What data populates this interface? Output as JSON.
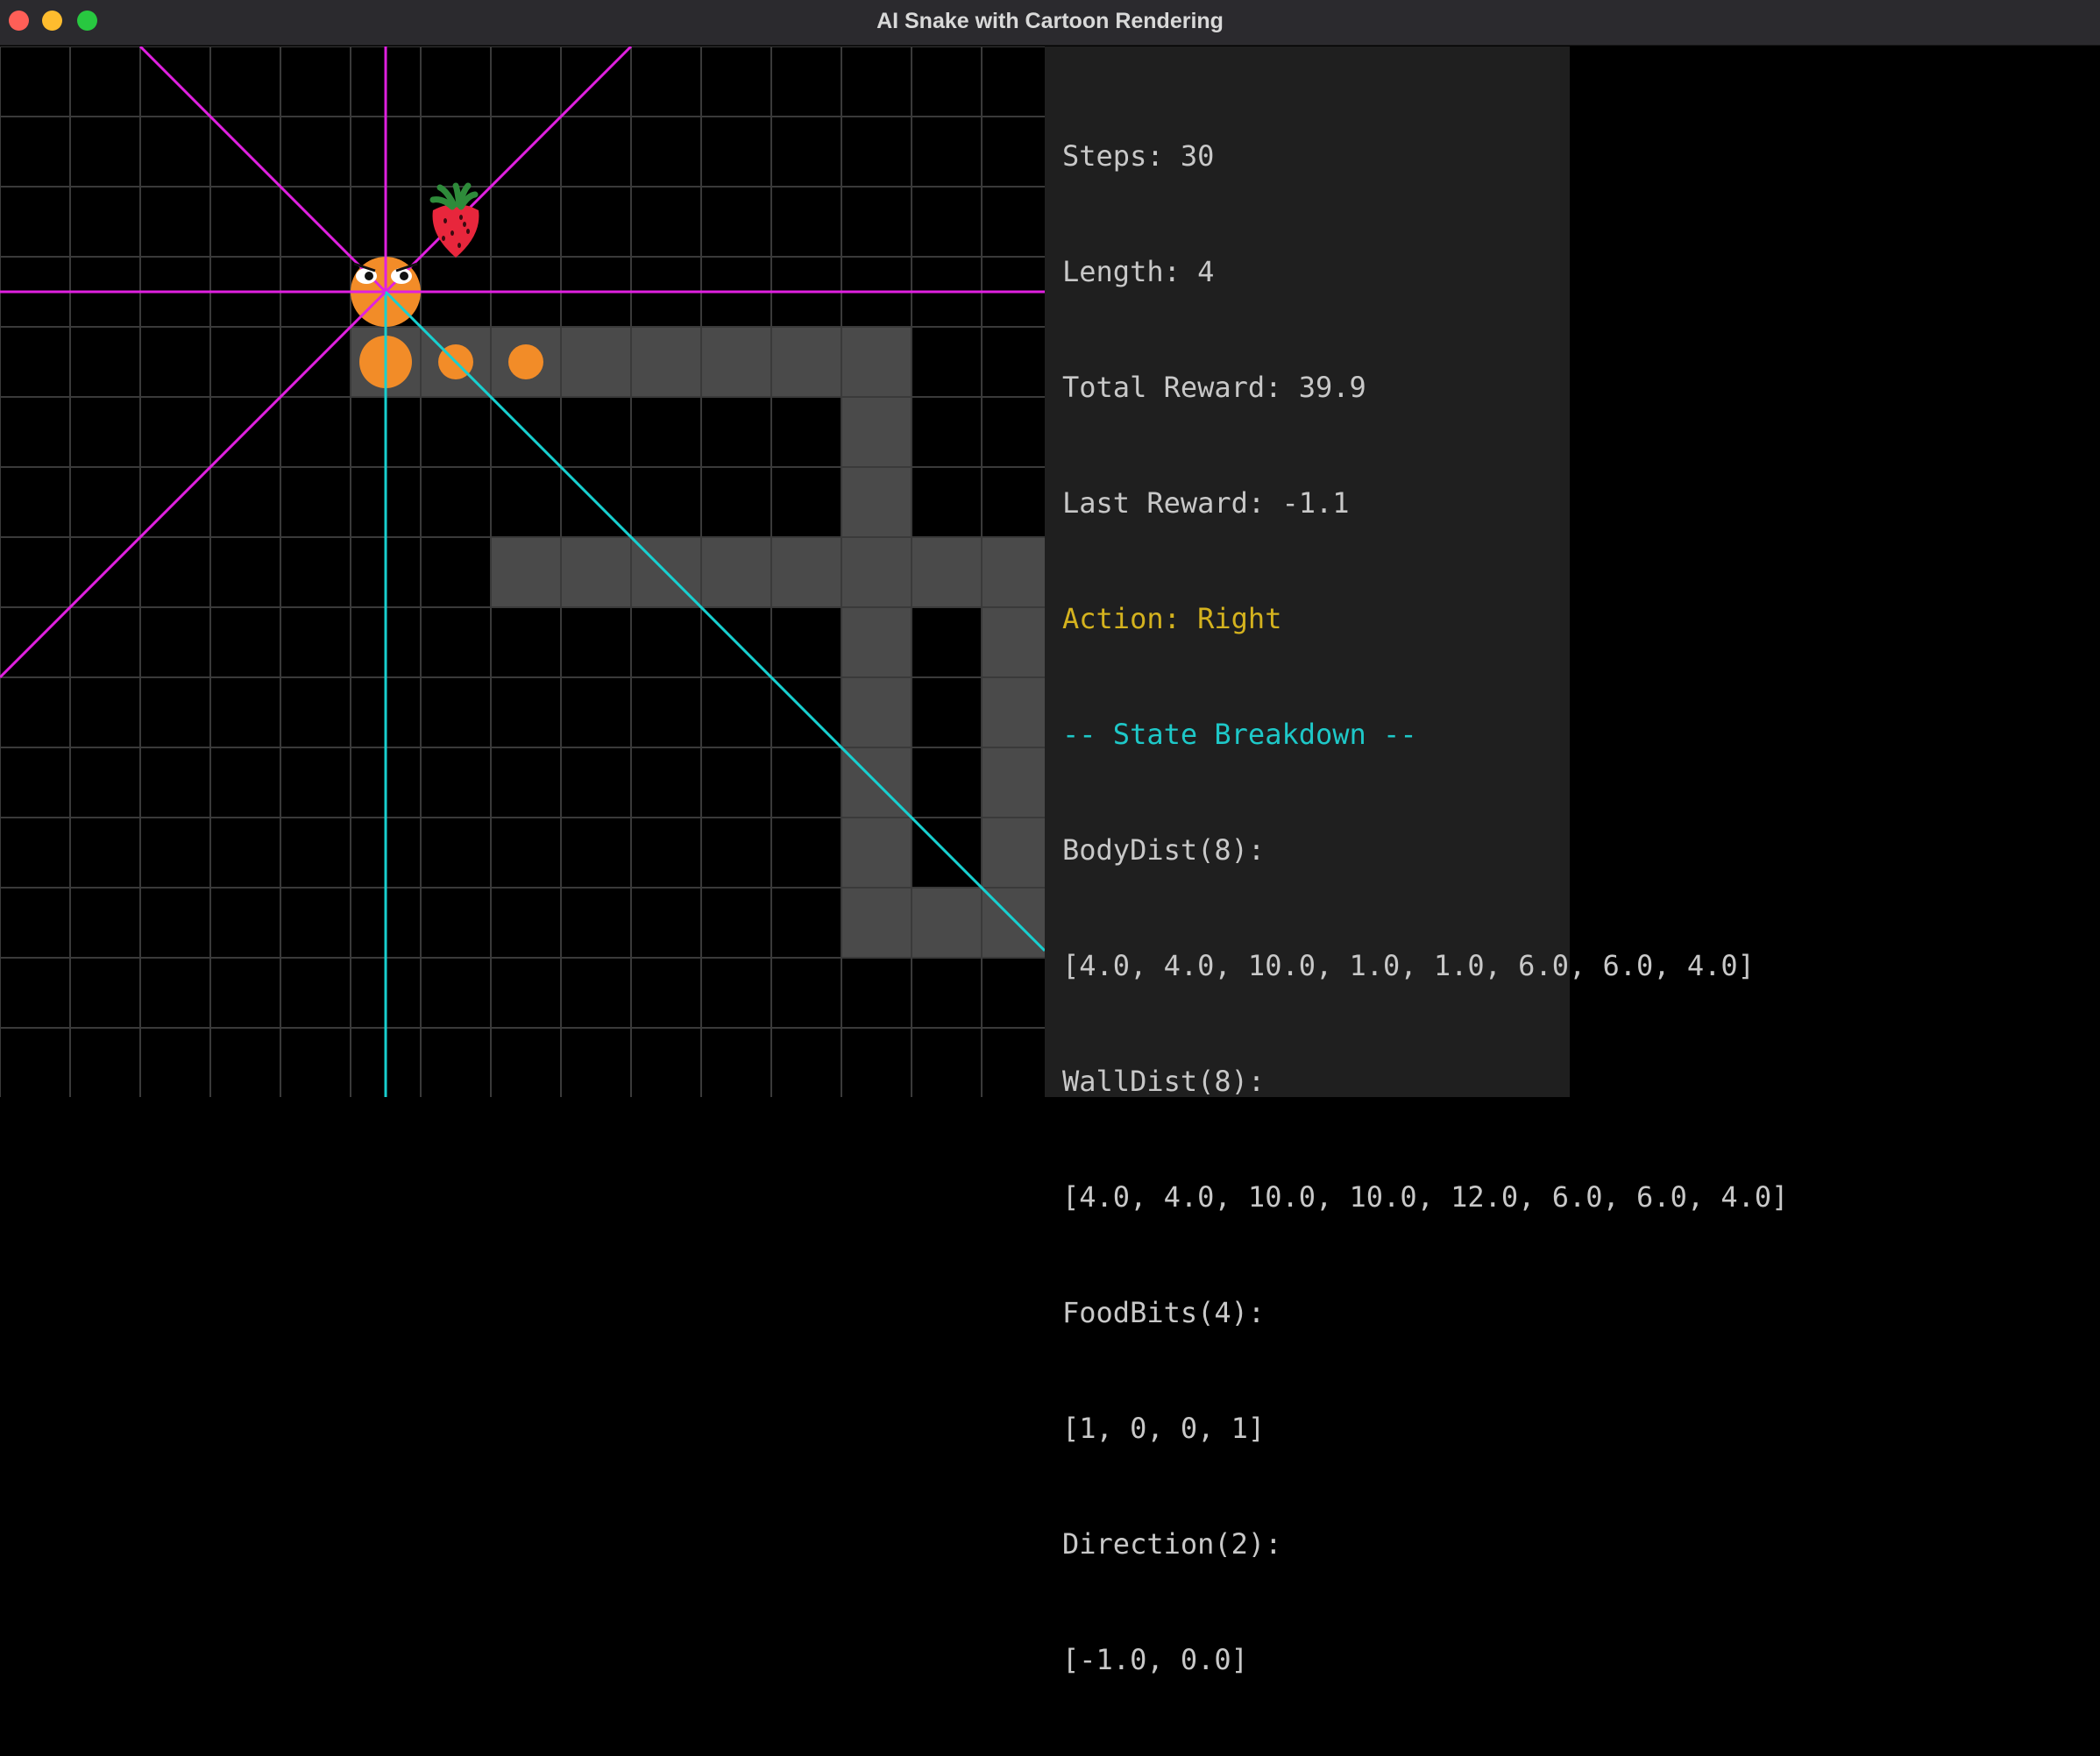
{
  "window": {
    "title": "AI Snake with Cartoon Rendering"
  },
  "colors": {
    "titlebar": "#2b2a2e",
    "board_bg": "#000000",
    "grid_line": "#3a3a3a",
    "obstacle": "#4a4a4a",
    "snake": "#f28c28",
    "food": "#e8263c",
    "ray_magenta": "#e020e0",
    "ray_cyan": "#18d0d0",
    "panel_bg": "#1f1f1f",
    "text_default": "#c8c8c8",
    "text_action": "#d4b21e",
    "text_header": "#1ec8c8"
  },
  "board": {
    "cols": 15,
    "rows": 15,
    "obstacles": [
      [
        5,
        4
      ],
      [
        6,
        4
      ],
      [
        7,
        4
      ],
      [
        8,
        4
      ],
      [
        9,
        4
      ],
      [
        10,
        4
      ],
      [
        11,
        4
      ],
      [
        12,
        4
      ],
      [
        12,
        5
      ],
      [
        12,
        6
      ],
      [
        7,
        7
      ],
      [
        8,
        7
      ],
      [
        9,
        7
      ],
      [
        10,
        7
      ],
      [
        11,
        7
      ],
      [
        12,
        7
      ],
      [
        13,
        7
      ],
      [
        14,
        7
      ],
      [
        12,
        8
      ],
      [
        14,
        8
      ],
      [
        12,
        9
      ],
      [
        14,
        9
      ],
      [
        12,
        10
      ],
      [
        14,
        10
      ],
      [
        12,
        11
      ],
      [
        14,
        11
      ],
      [
        12,
        12
      ],
      [
        13,
        12
      ],
      [
        14,
        12
      ]
    ],
    "snake": {
      "head": [
        5,
        3
      ],
      "body": [
        [
          5,
          4
        ],
        [
          6,
          4
        ],
        [
          7,
          4
        ]
      ],
      "icon": "snake-head-with-eyes"
    },
    "food": {
      "cell": [
        6,
        2
      ],
      "icon": "strawberry-icon"
    },
    "rays": [
      {
        "dir": "up",
        "color": "magenta"
      },
      {
        "dir": "down",
        "color": "cyan"
      },
      {
        "dir": "left",
        "color": "magenta"
      },
      {
        "dir": "right",
        "color": "magenta"
      },
      {
        "dir": "up-left",
        "color": "magenta"
      },
      {
        "dir": "up-right",
        "color": "magenta"
      },
      {
        "dir": "down-left",
        "color": "magenta"
      },
      {
        "dir": "down-right",
        "color": "cyan"
      }
    ]
  },
  "stats": {
    "steps": "Steps: 30",
    "length": "Length: 4",
    "total_reward": "Total Reward: 39.9",
    "last_reward": "Last Reward: -1.1",
    "action": "Action: Right",
    "state_header": "-- State Breakdown --",
    "body_dist_label": "BodyDist(8):",
    "body_dist_values": "[4.0, 4.0, 10.0, 1.0, 1.0, 6.0, 6.0, 4.0]",
    "wall_dist_label": "WallDist(8):",
    "wall_dist_values": "[4.0, 4.0, 10.0, 10.0, 12.0, 6.0, 6.0, 4.0]",
    "food_bits_label": "FoodBits(4):",
    "food_bits_values": "[1, 0, 0, 1]",
    "direction_label": "Direction(2):",
    "direction_values": "[-1.0, 0.0]"
  }
}
